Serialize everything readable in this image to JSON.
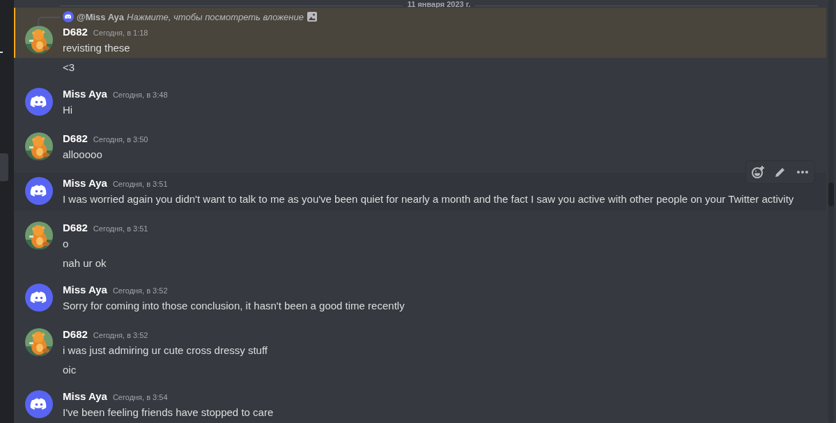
{
  "date_divider": "11 января 2023 г.",
  "messages": [
    {
      "author": "D682",
      "avatar": {
        "kind": "picture"
      },
      "time": "Сегодня, в 1:18",
      "hovered": false,
      "reply": {
        "author": "@Miss Aya",
        "text": "Нажмите, чтобы посмотреть вложение"
      },
      "lines": [
        {
          "text": "revisting these",
          "mentioned": true
        },
        {
          "text": "<3",
          "mentioned": false
        }
      ]
    },
    {
      "author": "Miss Aya",
      "avatar": {
        "kind": "discord"
      },
      "time": "Сегодня, в 3:48",
      "hovered": false,
      "lines": [
        {
          "text": "Hi",
          "mentioned": false
        }
      ]
    },
    {
      "author": "D682",
      "avatar": {
        "kind": "picture"
      },
      "time": "Сегодня, в 3:50",
      "hovered": false,
      "lines": [
        {
          "text": "allooooo",
          "mentioned": false
        }
      ]
    },
    {
      "author": "Miss Aya",
      "avatar": {
        "kind": "discord"
      },
      "time": "Сегодня, в 3:51",
      "hovered": true,
      "lines": [
        {
          "text": "I was worried again you didn't want to talk to me as you've been quiet for nearly a month and the fact I saw you active with other people on your Twitter activity",
          "mentioned": false
        }
      ]
    },
    {
      "author": "D682",
      "avatar": {
        "kind": "picture"
      },
      "time": "Сегодня, в 3:51",
      "hovered": false,
      "lines": [
        {
          "text": "o",
          "mentioned": false
        },
        {
          "text": "nah ur ok",
          "mentioned": false
        }
      ]
    },
    {
      "author": "Miss Aya",
      "avatar": {
        "kind": "discord"
      },
      "time": "Сегодня, в 3:52",
      "hovered": false,
      "lines": [
        {
          "text": "Sorry for coming into those conclusion, it hasn't been a good time recently",
          "mentioned": false
        }
      ]
    },
    {
      "author": "D682",
      "avatar": {
        "kind": "picture"
      },
      "time": "Сегодня, в 3:52",
      "hovered": false,
      "lines": [
        {
          "text": "i was just admiring ur cute cross dressy stuff",
          "mentioned": false
        },
        {
          "text": "oic",
          "mentioned": false
        }
      ]
    },
    {
      "author": "Miss Aya",
      "avatar": {
        "kind": "discord"
      },
      "time": "Сегодня, в 3:54",
      "hovered": false,
      "lines": [
        {
          "text": "I've been feeling friends have stopped to care",
          "mentioned": false
        }
      ]
    }
  ]
}
